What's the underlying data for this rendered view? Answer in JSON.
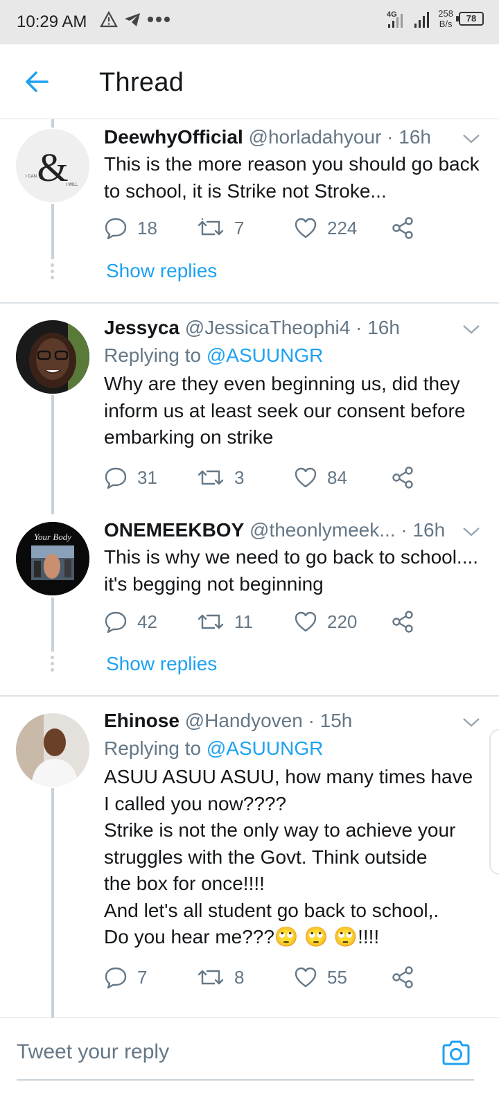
{
  "status_bar": {
    "time": "10:29 AM",
    "network": "4G",
    "speed_value": "258",
    "speed_unit": "B/s",
    "battery": "78"
  },
  "header": {
    "title": "Thread",
    "back_icon": "arrow-left-icon"
  },
  "colors": {
    "accent": "#1da1f2",
    "muted_text": "#657786",
    "primary_text": "#14171a",
    "divider": "#dde2e6"
  },
  "tweets": [
    {
      "name": "DeewhyOfficial",
      "handle": "@horladahyour",
      "time": "· 16h",
      "replying_label": "",
      "replying_to": "",
      "text": "This is the more reason you should go back to school, it is Strike not Stroke...",
      "replies": "18",
      "retweets": "7",
      "likes": "224",
      "show_replies": "Show replies"
    },
    {
      "name": "Jessyca",
      "handle": "@JessicaTheophi4",
      "time": "· 16h",
      "replying_label": "Replying to",
      "replying_to": "@ASUUNGR",
      "text": "Why are they even beginning us, did they inform us at least seek our consent before embarking on strike",
      "replies": "31",
      "retweets": "3",
      "likes": "84",
      "show_replies": ""
    },
    {
      "name": "ONEMEEKBOY",
      "handle": "@theonlymeek...",
      "time": "· 16h",
      "replying_label": "",
      "replying_to": "",
      "text": "This is why we need to go back to school.... it's begging not beginning",
      "replies": "42",
      "retweets": "11",
      "likes": "220",
      "show_replies": "Show replies"
    },
    {
      "name": "Ehinose",
      "handle": "@Handyoven",
      "time": "· 15h",
      "replying_label": "Replying to",
      "replying_to": "@ASUUNGR",
      "text_lines": [
        "ASUU ASUU ASUU, how many times have",
        "I called you now????",
        "Strike is not the only way to achieve your",
        "struggles with the Govt. Think outside",
        "the box for once!!!!",
        "And let's all student go back to school,.",
        "Do you hear me???🙄 🙄 🙄!!!!"
      ],
      "replies": "7",
      "retweets": "8",
      "likes": "55",
      "show_replies": ""
    }
  ],
  "avatars": {
    "t0_logo_text": "&",
    "t0_left_small": "I CAN",
    "t0_right_small": "I WILL",
    "t2_script": "Your Body"
  },
  "reply_bar": {
    "placeholder": "Tweet your reply",
    "camera_icon": "camera-icon"
  }
}
